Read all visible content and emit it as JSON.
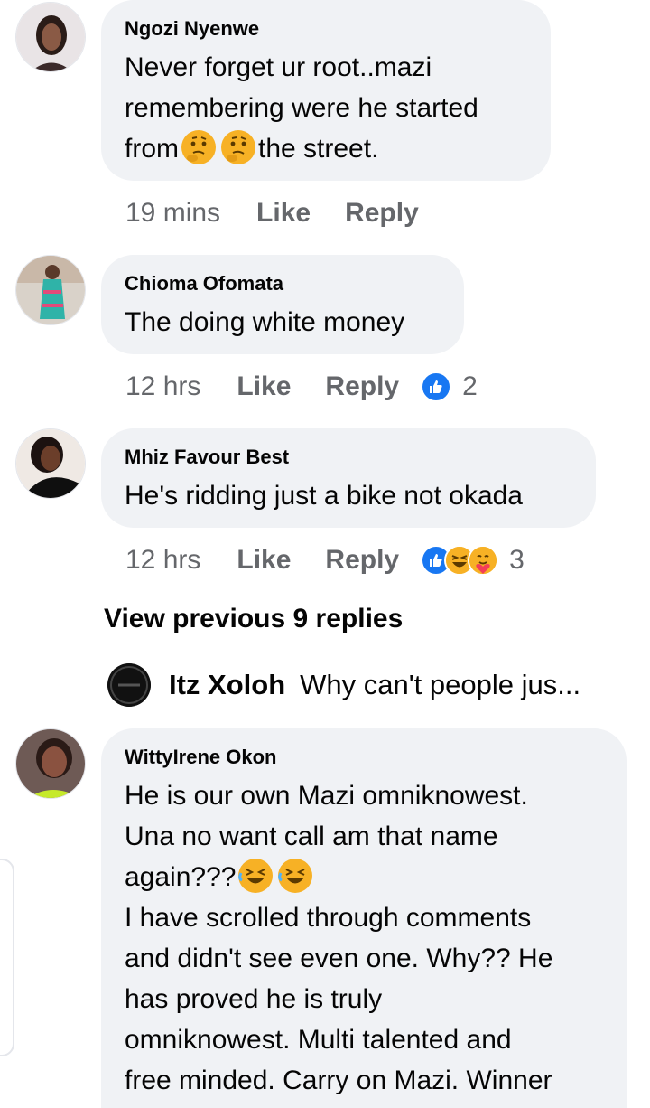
{
  "comments": [
    {
      "author": "Ngozi Nyenwe",
      "text_lines": [
        "Never forget ur root..mazi",
        "remembering were he started"
      ],
      "text_line3_a": "from",
      "text_line3_b": "the street.",
      "time": "19 mins",
      "like": "Like",
      "reply": "Reply"
    },
    {
      "author": "Chioma Ofomata",
      "text": "The doing white money",
      "time": "12 hrs",
      "like": "Like",
      "reply": "Reply",
      "reaction_count": "2"
    },
    {
      "author": "Mhiz Favour Best",
      "text": "He's ridding just a bike not okada",
      "time": "12 hrs",
      "like": "Like",
      "reply": "Reply",
      "reaction_count": "3"
    },
    {
      "author": "WittyIrene Okon",
      "line1": "He is our own Mazi omniknowest.",
      "line2": "Una no want call am that name",
      "line3": "again???",
      "line4": "I have scrolled through comments",
      "line5": "and didn't see even one. Why?? He",
      "line6": "has proved he is truly",
      "line7": "omniknowest. Multi talented and",
      "line8": "free minded. Carry on Mazi. Winner"
    }
  ],
  "view_previous": "View previous 9 replies",
  "reply_preview": {
    "name": "Itz Xoloh",
    "snippet": "Why can't people jus..."
  },
  "colors": {
    "bubble": "#f0f2f5",
    "meta": "#65676b",
    "like_blue": "#1877f2",
    "emoji_yellow": "#f7b125"
  },
  "icons": [
    "thinking-emoji-icon",
    "like-reaction-icon",
    "haha-reaction-icon",
    "care-reaction-icon",
    "laughing-emoji-icon"
  ]
}
